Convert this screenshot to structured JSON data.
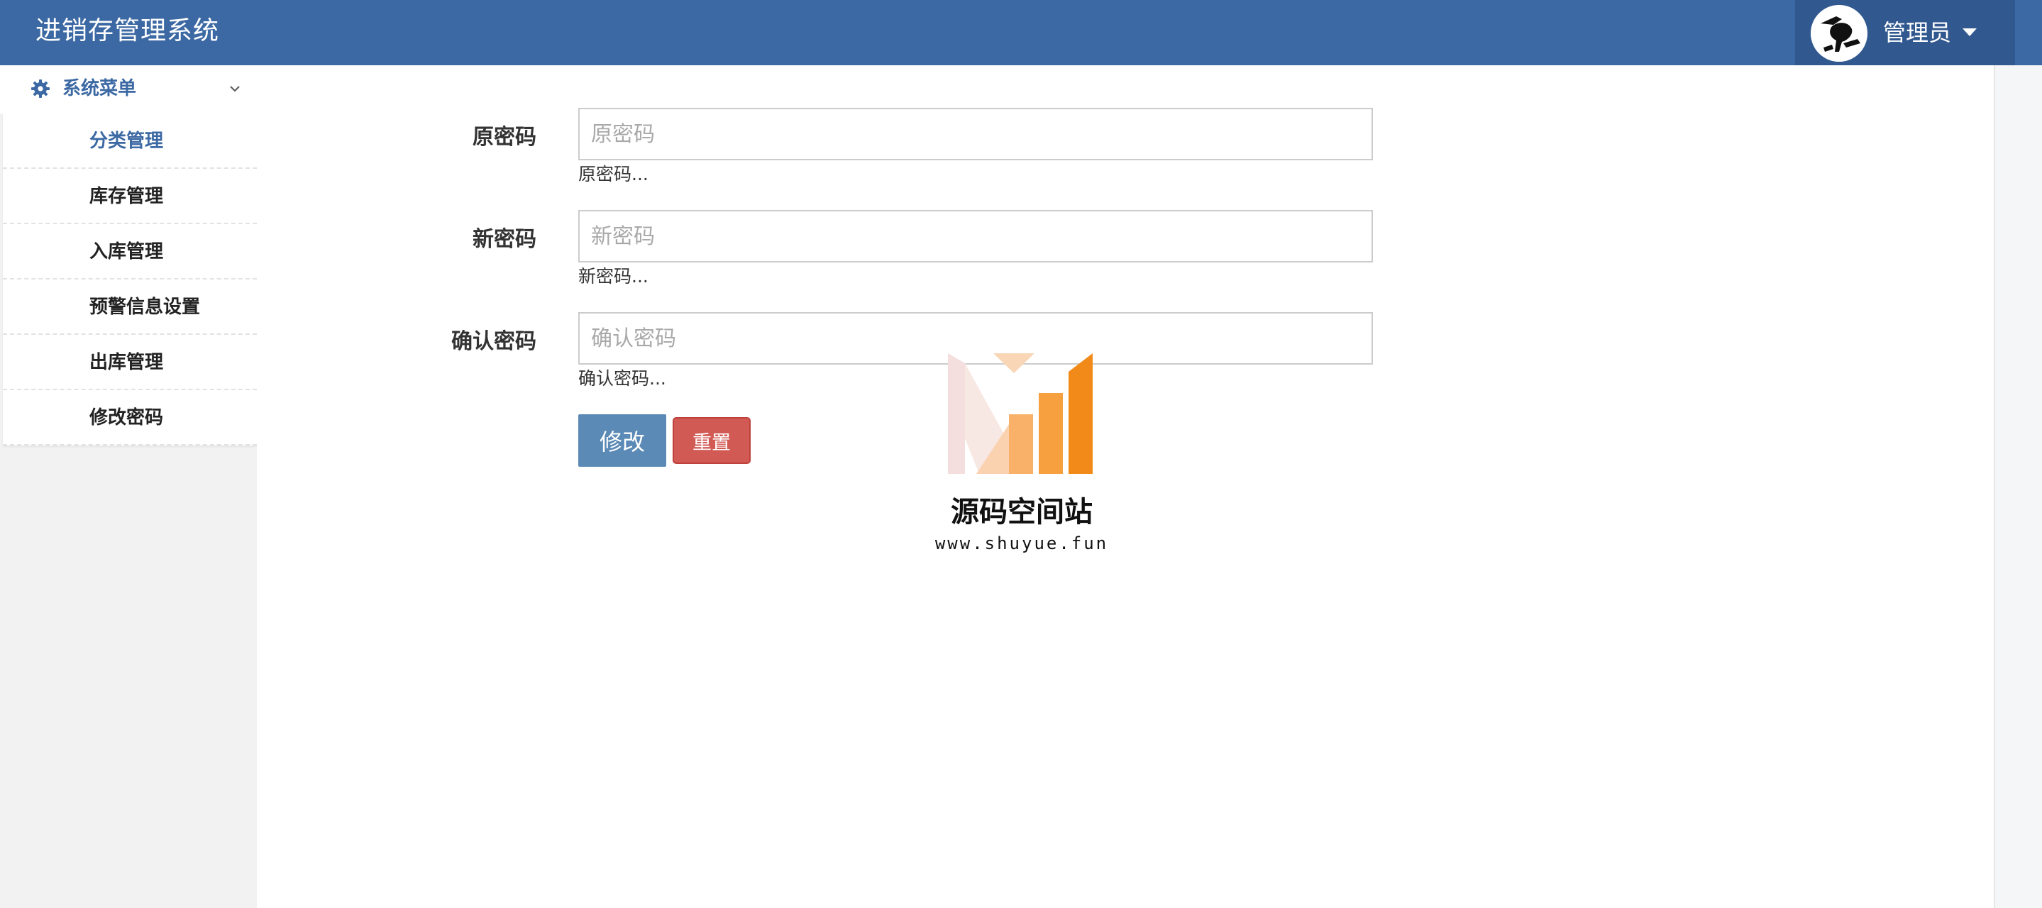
{
  "header": {
    "app_title": "进销存管理系统",
    "user_name": "管理员"
  },
  "sidebar": {
    "menu_header": "系统菜单",
    "items": [
      {
        "label": "分类管理",
        "active": true
      },
      {
        "label": "库存管理",
        "active": false
      },
      {
        "label": "入库管理",
        "active": false
      },
      {
        "label": "预警信息设置",
        "active": false
      },
      {
        "label": "出库管理",
        "active": false
      },
      {
        "label": "修改密码",
        "active": false
      }
    ]
  },
  "form": {
    "old_password": {
      "label": "原密码",
      "placeholder": "原密码",
      "help": "原密码...",
      "value": ""
    },
    "new_password": {
      "label": "新密码",
      "placeholder": "新密码",
      "help": "新密码...",
      "value": ""
    },
    "confirm_password": {
      "label": "确认密码",
      "placeholder": "确认密码",
      "help": "确认密码...",
      "value": ""
    },
    "submit_label": "修改",
    "reset_label": "重置"
  },
  "watermark": {
    "title": "源码空间站",
    "url": "www.shuyue.fun"
  },
  "colors": {
    "header_bg": "#3c69a3",
    "user_area_bg": "#31598f",
    "accent": "#3c69a3",
    "primary_button": "#5b8ab6",
    "danger_button": "#d25a55",
    "watermark_orange": "#f08a1c"
  },
  "icons": {
    "menu_header": "gear-icon",
    "menu_toggle": "chevron-down-icon",
    "user_menu": "caret-down-icon"
  }
}
